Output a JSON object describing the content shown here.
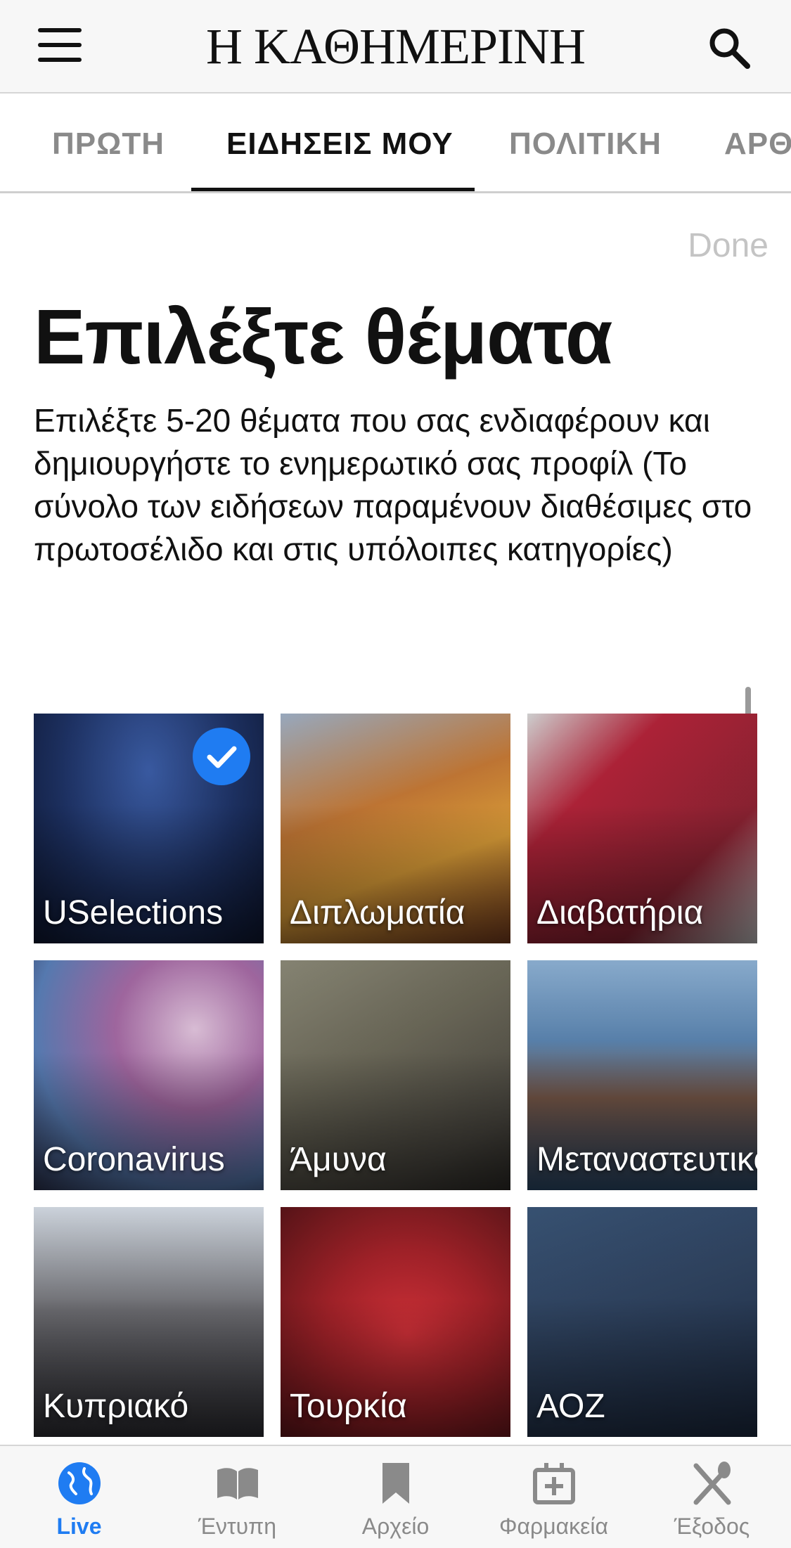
{
  "header": {
    "logo": "Η ΚΑΘΗΜΕΡΙΝΗ",
    "menu_icon": "hamburger-menu-icon",
    "search_icon": "search-icon"
  },
  "tabs": [
    {
      "label": "ΠΡΩΤΗ",
      "active": false
    },
    {
      "label": "ΕΙΔΗΣΕΙΣ ΜΟΥ",
      "active": true
    },
    {
      "label": "ΠΟΛΙΤΙΚΗ",
      "active": false
    },
    {
      "label": "ΑΡΘΡΑ",
      "active": false
    }
  ],
  "content": {
    "done_label": "Done",
    "title": "Επιλέξτε θέματα",
    "description": "Επιλέξτε 5-20 θέματα που σας ενδιαφέρουν και δημιουργήστε το ενημερωτικό σας προφίλ (Το σύνολο των ειδήσεων παραμένουν διαθέσιμες στο πρωτοσέλιδο και στις υπόλοιπες κατηγορίες)"
  },
  "topics": [
    {
      "label": "USelections",
      "selected": true,
      "color": "#1d3163"
    },
    {
      "label": "Διπλωματία",
      "selected": false,
      "color": "#a45a2a"
    },
    {
      "label": "Διαβατήρια",
      "selected": false,
      "color": "#8e2333"
    },
    {
      "label": "Coronavirus",
      "selected": false,
      "color": "#7d5c8a"
    },
    {
      "label": "Άμυνα",
      "selected": false,
      "color": "#6d6a5a"
    },
    {
      "label": "Μεταναστευτικό",
      "selected": false,
      "color": "#3a5f86"
    },
    {
      "label": "Κυπριακό",
      "selected": false,
      "color": "#4d4d52"
    },
    {
      "label": "Τουρκία",
      "selected": false,
      "color": "#a8232a"
    },
    {
      "label": "ΑΟΖ",
      "selected": false,
      "color": "#2f4360"
    }
  ],
  "bottom_nav": [
    {
      "label": "Live",
      "icon": "globe-icon",
      "active": true
    },
    {
      "label": "Έντυπη",
      "icon": "book-icon",
      "active": false
    },
    {
      "label": "Αρχείο",
      "icon": "bookmark-icon",
      "active": false
    },
    {
      "label": "Φαρμακεία",
      "icon": "pharmacy-icon",
      "active": false
    },
    {
      "label": "Έξοδος",
      "icon": "fork-knife-icon",
      "active": false
    }
  ],
  "colors": {
    "accent": "#1f7cf2",
    "inactive_text": "#8a8a8a"
  }
}
